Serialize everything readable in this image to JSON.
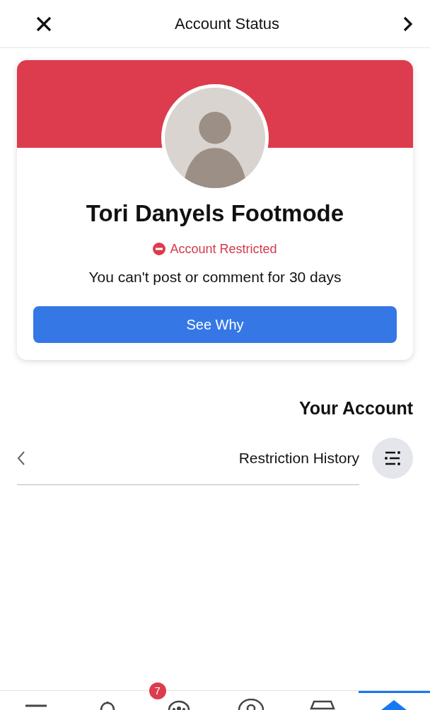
{
  "header": {
    "title": "Account Status"
  },
  "profile": {
    "name": "Tori Danyels Footmode",
    "status": "Account Restricted",
    "message": "You can't post or comment for 30 days",
    "button": "See Why"
  },
  "your_account": {
    "heading": "Your Account",
    "items": [
      {
        "label": "Restriction History"
      }
    ]
  },
  "bottom_nav": [
    {
      "kind": "menu",
      "selected": false
    },
    {
      "kind": "bell",
      "selected": false
    },
    {
      "kind": "groups",
      "selected": false,
      "badge": "7"
    },
    {
      "kind": "profile",
      "selected": false
    },
    {
      "kind": "store",
      "selected": false
    },
    {
      "kind": "home",
      "selected": true
    }
  ]
}
